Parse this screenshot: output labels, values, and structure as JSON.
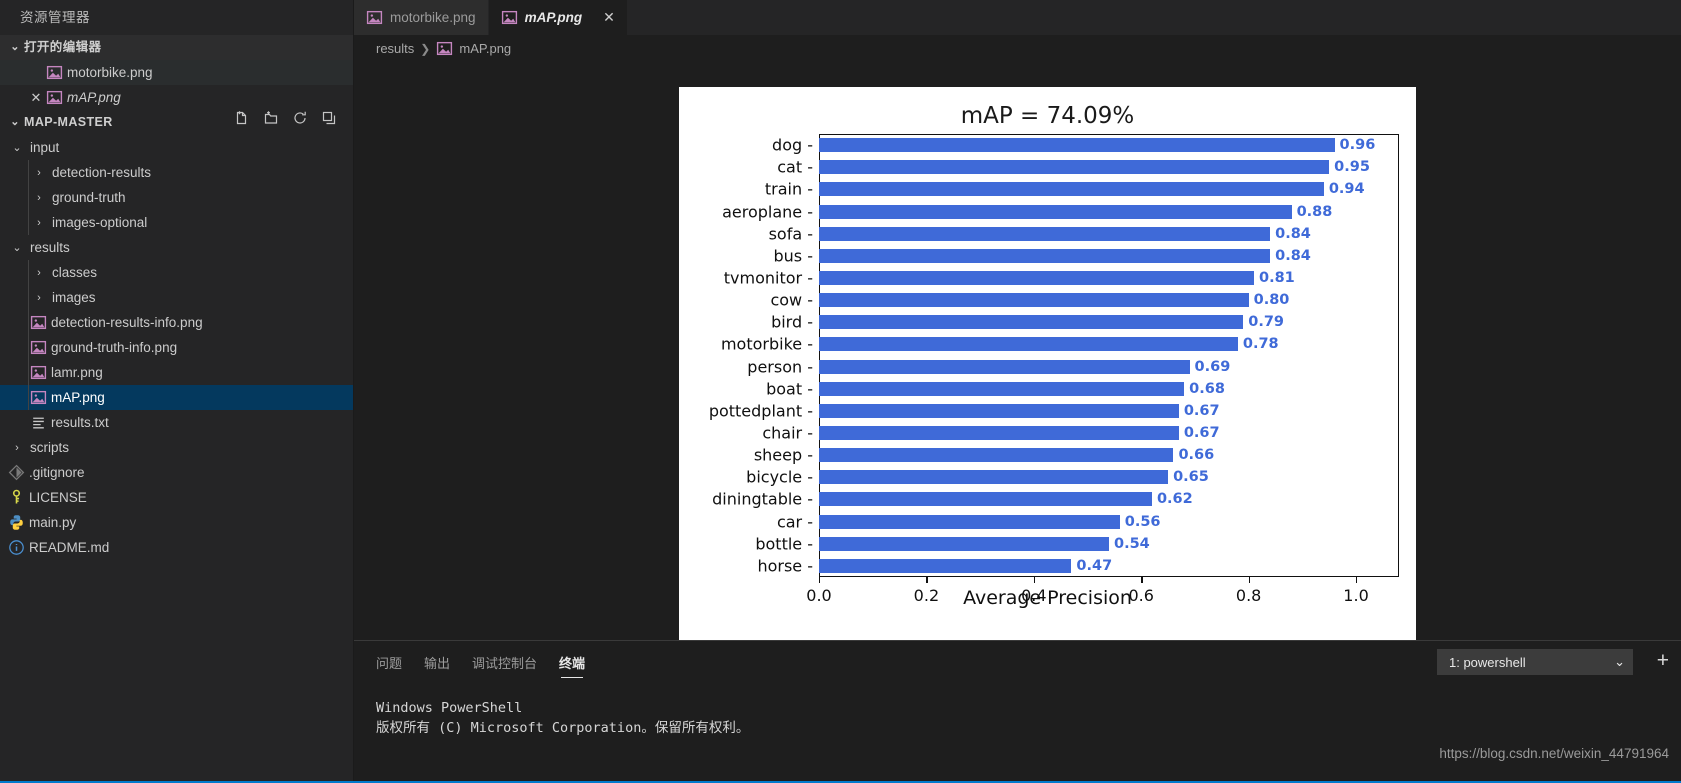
{
  "sidebar": {
    "title": "资源管理器",
    "open_editors": {
      "label": "打开的编辑器",
      "items": [
        {
          "label": "motorbike.png",
          "icon": "image-file-icon",
          "close": ""
        },
        {
          "label": "mAP.png",
          "icon": "image-file-icon",
          "close": "✕"
        }
      ]
    },
    "project": {
      "label": "MAP-MASTER",
      "actions": [
        "new-file-icon",
        "new-folder-icon",
        "refresh-icon",
        "collapse-all-icon"
      ]
    },
    "tree": [
      {
        "label": "input",
        "type": "folder",
        "expanded": true,
        "depth": 1,
        "icon": "chevron-down-icon"
      },
      {
        "label": "detection-results",
        "type": "folder",
        "expanded": false,
        "depth": 2,
        "icon": "chevron-right-icon"
      },
      {
        "label": "ground-truth",
        "type": "folder",
        "expanded": false,
        "depth": 2,
        "icon": "chevron-right-icon"
      },
      {
        "label": "images-optional",
        "type": "folder",
        "expanded": false,
        "depth": 2,
        "icon": "chevron-right-icon"
      },
      {
        "label": "results",
        "type": "folder",
        "expanded": true,
        "depth": 1,
        "icon": "chevron-down-icon"
      },
      {
        "label": "classes",
        "type": "folder",
        "expanded": false,
        "depth": 2,
        "icon": "chevron-right-icon"
      },
      {
        "label": "images",
        "type": "folder",
        "expanded": false,
        "depth": 2,
        "icon": "chevron-right-icon"
      },
      {
        "label": "detection-results-info.png",
        "type": "image",
        "depth": 2,
        "icon": "image-file-icon"
      },
      {
        "label": "ground-truth-info.png",
        "type": "image",
        "depth": 2,
        "icon": "image-file-icon"
      },
      {
        "label": "lamr.png",
        "type": "image",
        "depth": 2,
        "icon": "image-file-icon"
      },
      {
        "label": "mAP.png",
        "type": "image",
        "depth": 2,
        "icon": "image-file-icon",
        "selected": true
      },
      {
        "label": "results.txt",
        "type": "text",
        "depth": 2,
        "icon": "text-file-icon"
      },
      {
        "label": "scripts",
        "type": "folder",
        "expanded": false,
        "depth": 1,
        "icon": "chevron-right-icon"
      },
      {
        "label": ".gitignore",
        "type": "git",
        "depth": 1,
        "icon": "git-icon"
      },
      {
        "label": "LICENSE",
        "type": "license",
        "depth": 1,
        "icon": "key-icon"
      },
      {
        "label": "main.py",
        "type": "python",
        "depth": 1,
        "icon": "python-icon"
      },
      {
        "label": "README.md",
        "type": "info",
        "depth": 1,
        "icon": "info-icon"
      }
    ]
  },
  "tabs": [
    {
      "label": "motorbike.png",
      "active": false,
      "icon": "image-file-icon"
    },
    {
      "label": "mAP.png",
      "active": true,
      "icon": "image-file-icon",
      "close": "✕"
    }
  ],
  "breadcrumb": {
    "folder": "results",
    "separator": "❯",
    "file": "mAP.png"
  },
  "panel": {
    "tabs": [
      {
        "label": "问题",
        "active": false
      },
      {
        "label": "输出",
        "active": false
      },
      {
        "label": "调试控制台",
        "active": false
      },
      {
        "label": "终端",
        "active": true
      }
    ],
    "terminal_select": {
      "value": "1: powershell",
      "chevron": "⌄"
    },
    "add_button": "+",
    "terminal_lines": [
      "Windows PowerShell",
      "版权所有 (C) Microsoft Corporation。保留所有权利。"
    ]
  },
  "watermark": "https://blog.csdn.net/weixin_44791964",
  "colors": {
    "bar": "#3f6ad8",
    "value_text": "#3f6ad8",
    "selection": "#04395e",
    "accent": "#007acc"
  },
  "chart_data": {
    "type": "bar",
    "orientation": "horizontal",
    "title": "mAP = 74.09%",
    "xlabel": "Average Precision",
    "ylabel": "",
    "xlim": [
      0,
      1.08
    ],
    "xticks": [
      0.0,
      0.2,
      0.4,
      0.6,
      0.8,
      1.0
    ],
    "xtick_labels": [
      "0.0",
      "0.2",
      "0.4",
      "0.6",
      "0.8",
      "1.0"
    ],
    "grid": false,
    "legend": null,
    "categories": [
      "dog",
      "cat",
      "train",
      "aeroplane",
      "sofa",
      "bus",
      "tvmonitor",
      "cow",
      "bird",
      "motorbike",
      "person",
      "boat",
      "pottedplant",
      "chair",
      "sheep",
      "bicycle",
      "diningtable",
      "car",
      "bottle",
      "horse"
    ],
    "values": [
      0.96,
      0.95,
      0.94,
      0.88,
      0.84,
      0.84,
      0.81,
      0.8,
      0.79,
      0.78,
      0.69,
      0.68,
      0.67,
      0.67,
      0.66,
      0.65,
      0.62,
      0.56,
      0.54,
      0.47
    ],
    "value_labels": [
      "0.96",
      "0.95",
      "0.94",
      "0.88",
      "0.84",
      "0.84",
      "0.81",
      "0.80",
      "0.79",
      "0.78",
      "0.69",
      "0.68",
      "0.67",
      "0.67",
      "0.66",
      "0.65",
      "0.62",
      "0.56",
      "0.54",
      "0.47"
    ]
  }
}
